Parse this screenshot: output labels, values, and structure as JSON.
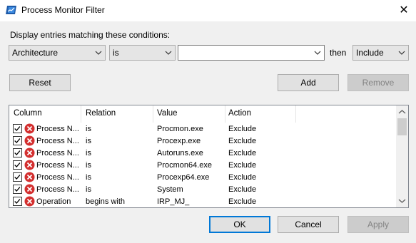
{
  "window": {
    "title": "Process Monitor Filter",
    "close_glyph": "✕"
  },
  "prompt": "Display entries matching these conditions:",
  "filter": {
    "column_value": "Architecture",
    "relation_value": "is",
    "value_text": "",
    "then_label": "then",
    "action_value": "Include"
  },
  "buttons": {
    "reset": "Reset",
    "add": "Add",
    "remove": "Remove",
    "ok": "OK",
    "cancel": "Cancel",
    "apply": "Apply"
  },
  "columns": [
    "Column",
    "Relation",
    "Value",
    "Action"
  ],
  "rows": [
    {
      "column": "Process N...",
      "relation": "is",
      "value": "Procmon.exe",
      "action": "Exclude",
      "checked": true
    },
    {
      "column": "Process N...",
      "relation": "is",
      "value": "Procexp.exe",
      "action": "Exclude",
      "checked": true
    },
    {
      "column": "Process N...",
      "relation": "is",
      "value": "Autoruns.exe",
      "action": "Exclude",
      "checked": true
    },
    {
      "column": "Process N...",
      "relation": "is",
      "value": "Procmon64.exe",
      "action": "Exclude",
      "checked": true
    },
    {
      "column": "Process N...",
      "relation": "is",
      "value": "Procexp64.exe",
      "action": "Exclude",
      "checked": true
    },
    {
      "column": "Process N...",
      "relation": "is",
      "value": "System",
      "action": "Exclude",
      "checked": true
    },
    {
      "column": "Operation",
      "relation": "begins with",
      "value": "IRP_MJ_",
      "action": "Exclude",
      "checked": true
    }
  ],
  "colors": {
    "exclude_icon": "#d32f2f",
    "focus_border": "#0078d7"
  },
  "icons": {
    "app": "procmon-icon",
    "row_action": "exclude-x-icon",
    "dropdown": "chevron-down-icon"
  }
}
